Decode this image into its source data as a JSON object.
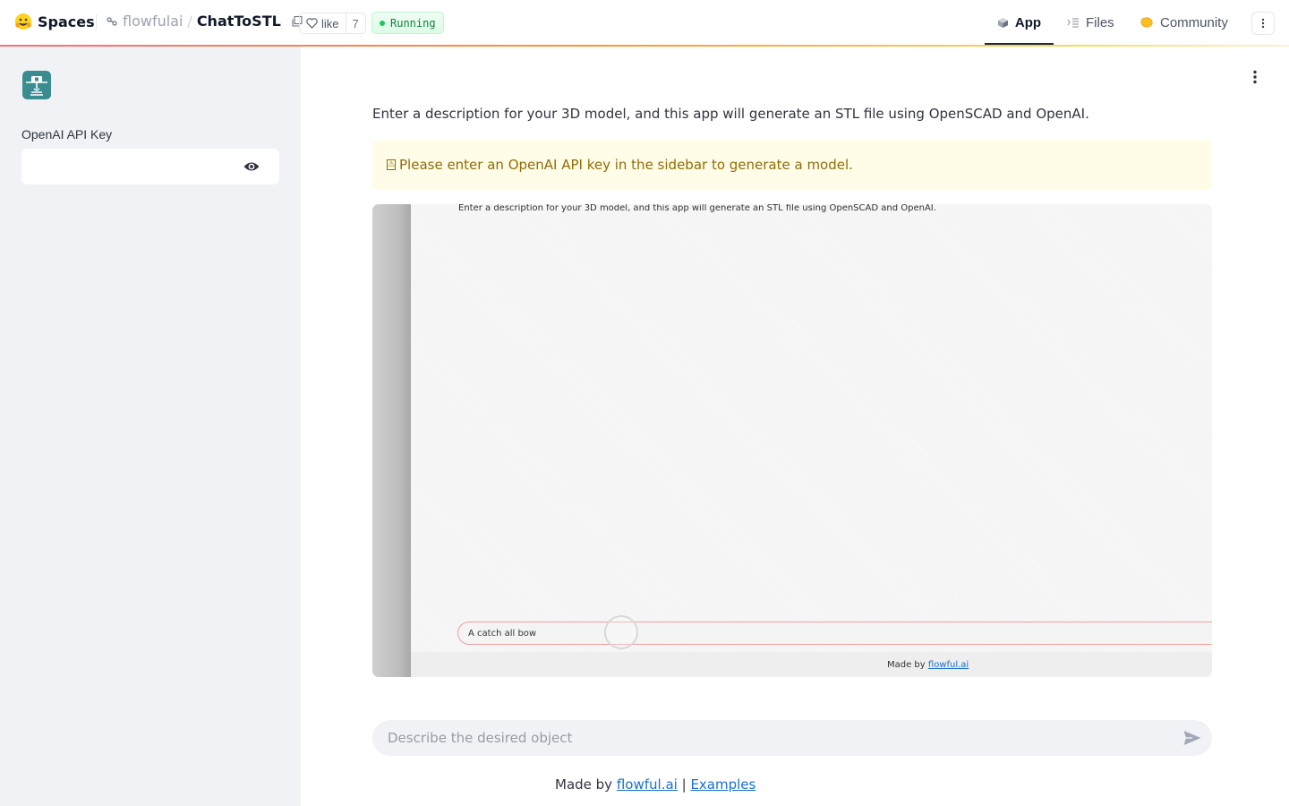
{
  "header": {
    "brand": "Spaces",
    "owner": "flowfulai",
    "separator": "/",
    "repo_name": "ChatToSTL",
    "like_label": "like",
    "like_count": "7",
    "status": "Running",
    "tabs": [
      {
        "label": "App",
        "icon": "cube-icon",
        "active": true
      },
      {
        "label": "Files",
        "icon": "files-icon",
        "active": false
      },
      {
        "label": "Community",
        "icon": "community-icon",
        "active": false
      }
    ]
  },
  "sidebar": {
    "api_key_label": "OpenAI API Key",
    "api_key_value": ""
  },
  "main": {
    "description": "Enter a description for your 3D model, and this app will generate an STL file using OpenSCAD and OpenAI.",
    "warning_icon": "⚠",
    "warning": "Please enter an OpenAI API key in the sidebar to generate a model.",
    "demo": {
      "description": "Enter a description for your 3D model, and this app will generate an STL file using OpenSCAD and OpenAI.",
      "input_value": "A catch all bow",
      "footer_prefix": "Made by",
      "footer_link": "flowful.ai"
    },
    "chat_placeholder": "Describe the desired object",
    "footer": {
      "prefix": "Made by",
      "link1": "flowful.ai",
      "separator": "|",
      "link2": "Examples"
    }
  },
  "colors": {
    "accent_warning_text": "#926c05",
    "warning_bg": "#fffce7",
    "status_green": "#22c55e",
    "link": "#1a6fcf",
    "sidebar_bg": "#f0f2f6"
  }
}
